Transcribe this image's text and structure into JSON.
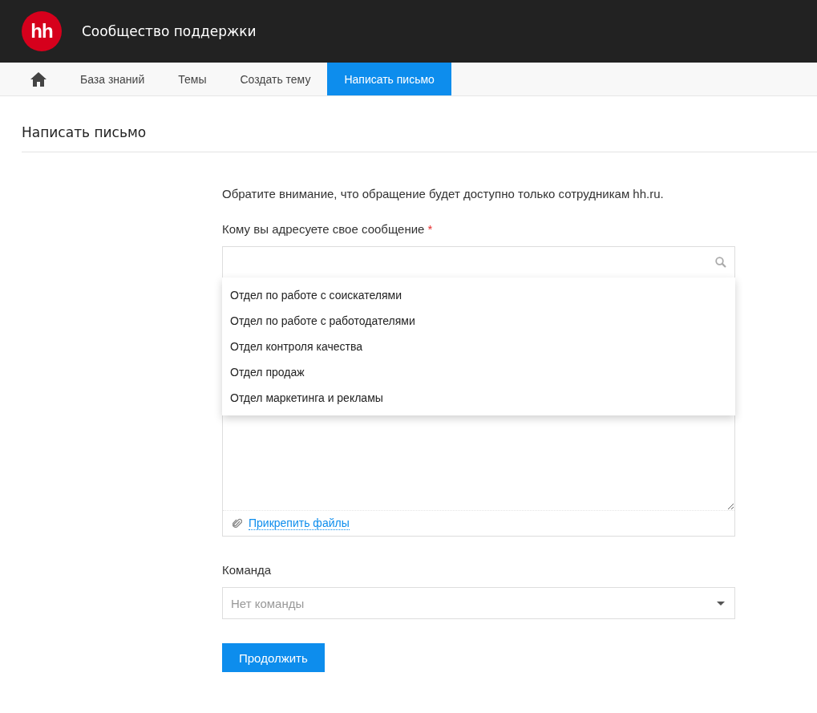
{
  "header": {
    "logo": "hh",
    "title": "Сообщество поддержки"
  },
  "nav": [
    {
      "kind": "home",
      "selected": false
    },
    {
      "kind": "text",
      "label": "База знаний",
      "selected": false
    },
    {
      "kind": "text",
      "label": "Темы",
      "selected": false
    },
    {
      "kind": "text",
      "label": "Создать тему",
      "selected": false
    },
    {
      "kind": "text",
      "label": "Написать письмо",
      "selected": true
    }
  ],
  "page_title": "Написать письмо",
  "form": {
    "notice": "Обратите внимание, что обращение будет доступно только сотрудникам hh.ru.",
    "recipient_label": "Кому вы адресуете свое сообщение",
    "required_mark": "*",
    "recipient_options": [
      "Отдел по работе с соискателями",
      "Отдел по работе с работодателями",
      "Отдел контроля качества",
      "Отдел продаж",
      "Отдел маркетинга и рекламы"
    ],
    "attach_link": "Прикрепить файлы",
    "team_label": "Команда",
    "team_placeholder": "Нет команды",
    "submit": "Продолжить"
  }
}
